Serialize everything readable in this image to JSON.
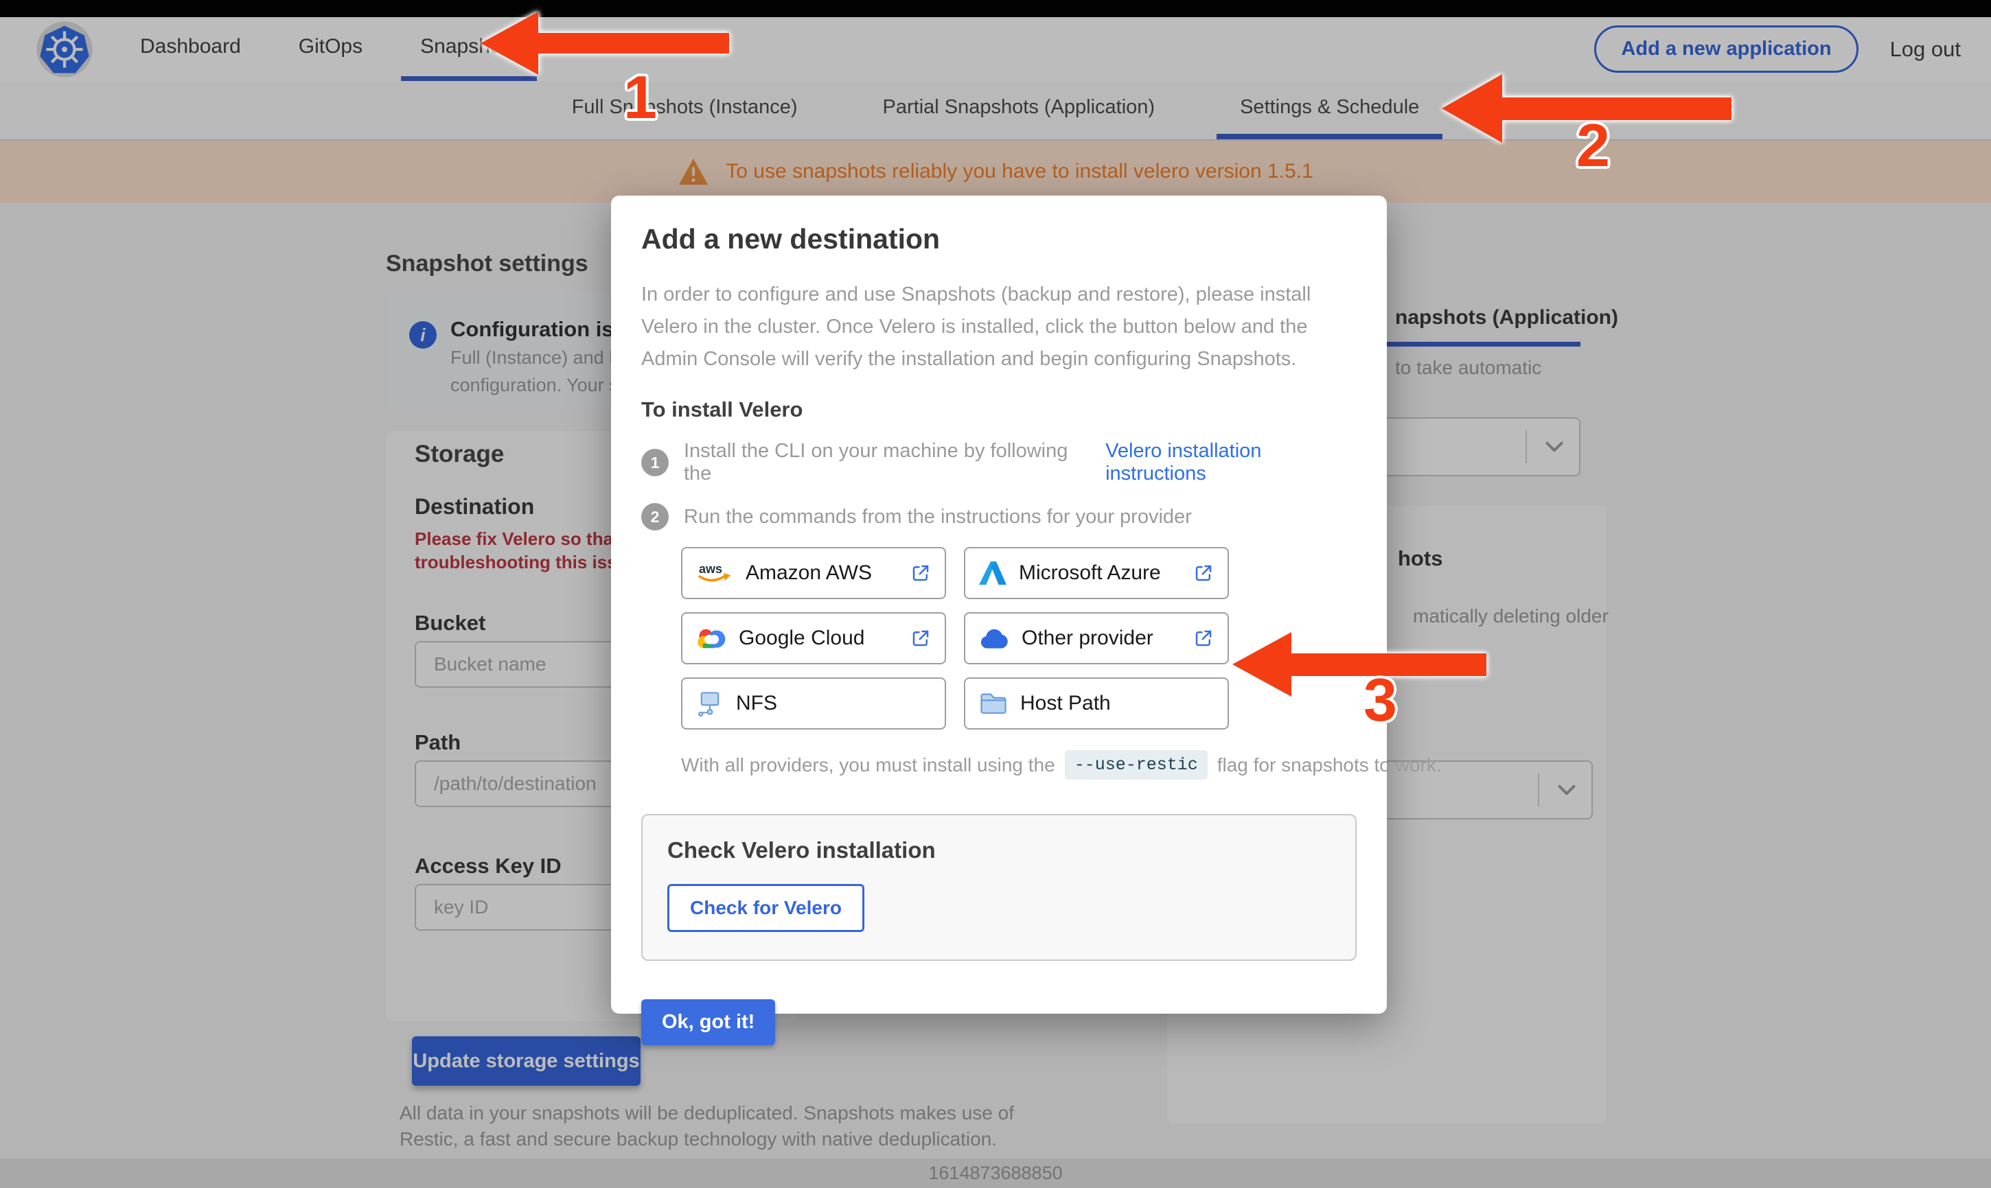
{
  "nav": {
    "items": [
      {
        "label": "Dashboard"
      },
      {
        "label": "GitOps"
      },
      {
        "label": "Snapshots"
      }
    ],
    "add_application_label": "Add a new application",
    "logout_label": "Log out"
  },
  "tabs": {
    "items": [
      {
        "label": "Full Snapshots (Instance)"
      },
      {
        "label": "Partial Snapshots (Application)"
      },
      {
        "label": "Settings & Schedule"
      }
    ]
  },
  "banner": {
    "text": "To use snapshots reliably you have to install velero version 1.5.1"
  },
  "page": {
    "snapshot_settings_heading": "Snapshot settings",
    "config_callout_title": "Configuration is sh",
    "config_callout_line1": "Full (Instance) and Parti",
    "config_callout_line2": "configuration. Your stor",
    "storage_heading": "Storage",
    "destination_label": "Destination",
    "error_line1": "Please fix Velero so that th",
    "error_line2": "troubleshooting this issue",
    "bucket_label": "Bucket",
    "bucket_placeholder": "Bucket name",
    "path_label": "Path",
    "path_placeholder": "/path/to/destination",
    "access_key_label": "Access Key ID",
    "access_key_placeholder": "key ID",
    "update_button_label": "Update storage settings",
    "dedup_line1": "All data in your snapshots will be deduplicated. Snapshots makes use of",
    "dedup_line2": "Restic, a fast and secure backup technology with native deduplication.",
    "right_tab_fragment": "napshots (Application)",
    "right_text_fragment1": "to take automatic",
    "right_heading_fragment": "hots",
    "right_text_fragment2": "matically deleting older",
    "footer_timestamp": "1614873688850"
  },
  "modal": {
    "title": "Add a new destination",
    "description": "In order to configure and use Snapshots (backup and restore), please install Velero in the cluster. Once Velero is installed, click the button below and the Admin Console will verify the installation and begin configuring Snapshots.",
    "install_heading": "To install Velero",
    "steps": [
      {
        "number": "1",
        "text": "Install the CLI on your machine by following the",
        "link": "Velero installation instructions"
      },
      {
        "number": "2",
        "text": "Run the commands from the instructions for your provider",
        "link": ""
      }
    ],
    "providers": [
      {
        "label": "Amazon AWS"
      },
      {
        "label": "Microsoft Azure"
      },
      {
        "label": "Google Cloud"
      },
      {
        "label": "Other provider"
      },
      {
        "label": "NFS"
      },
      {
        "label": "Host Path"
      }
    ],
    "restic_note_prefix": "With all providers, you must install using the",
    "restic_flag": "--use-restic",
    "restic_note_suffix": "flag for snapshots to work.",
    "check_heading": "Check Velero installation",
    "check_button_label": "Check for Velero",
    "ok_button_label": "Ok, got it!"
  },
  "annotations": {
    "arrow1": "1",
    "arrow2": "2",
    "arrow3": "3"
  },
  "icons": {
    "info_glyph": "i",
    "aws_text": "aws"
  },
  "colors": {
    "accent_blue": "#3566dd",
    "link_blue": "#2d6ee8",
    "underline_blue": "#3b5ec9",
    "banner_bg": "#ffe4cf",
    "banner_orange": "#f4802a",
    "error_red": "#bf3641",
    "arrow_red": "#f43d12"
  }
}
